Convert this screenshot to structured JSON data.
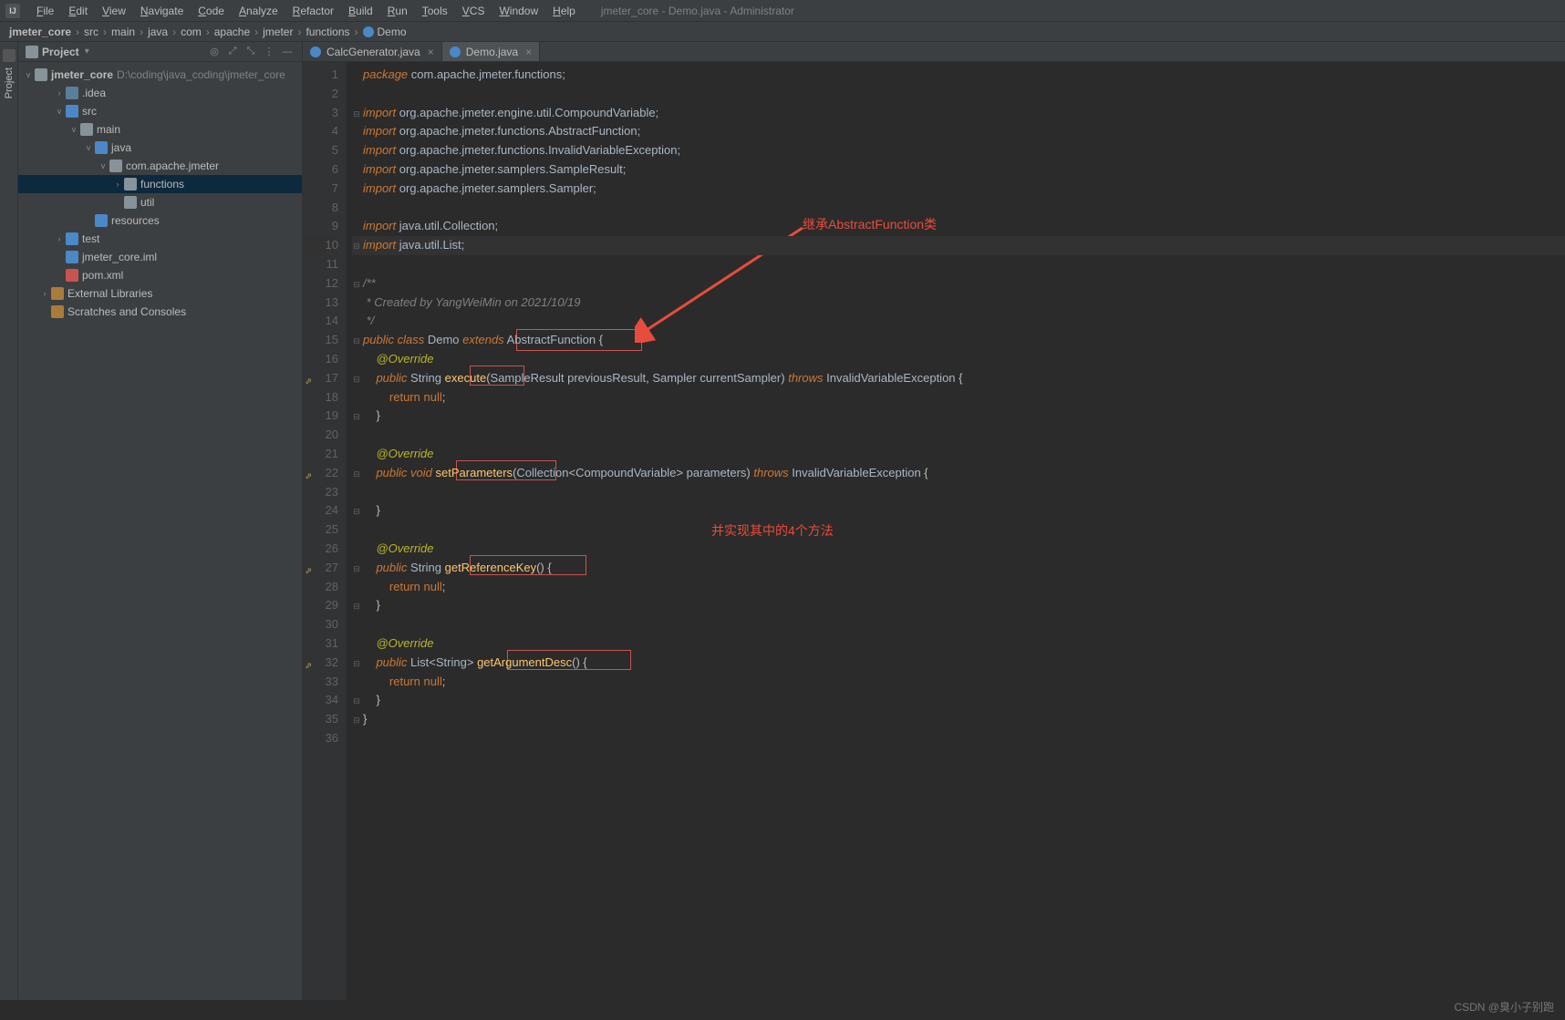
{
  "window": {
    "title": "jmeter_core - Demo.java - Administrator"
  },
  "menu": [
    "File",
    "Edit",
    "View",
    "Navigate",
    "Code",
    "Analyze",
    "Refactor",
    "Build",
    "Run",
    "Tools",
    "VCS",
    "Window",
    "Help"
  ],
  "breadcrumb": [
    "jmeter_core",
    "src",
    "main",
    "java",
    "com",
    "apache",
    "jmeter",
    "functions",
    "Demo"
  ],
  "project_panel": {
    "title": "Project",
    "root": {
      "label": "jmeter_core",
      "path": "D:\\coding\\java_coding\\jmeter_core"
    },
    "items": [
      {
        "indent": 1,
        "twist": "›",
        "icon": "ti-module",
        "label": ".idea"
      },
      {
        "indent": 1,
        "twist": "v",
        "icon": "ti-blue",
        "label": "src"
      },
      {
        "indent": 2,
        "twist": "v",
        "icon": "ti-folder",
        "label": "main"
      },
      {
        "indent": 3,
        "twist": "v",
        "icon": "ti-blue",
        "label": "java"
      },
      {
        "indent": 4,
        "twist": "v",
        "icon": "ti-pkg",
        "label": "com.apache.jmeter"
      },
      {
        "indent": 5,
        "twist": "›",
        "icon": "ti-pkg",
        "label": "functions",
        "sel": true
      },
      {
        "indent": 5,
        "twist": "",
        "icon": "ti-pkg",
        "label": "util"
      },
      {
        "indent": 3,
        "twist": "",
        "icon": "ti-blue",
        "label": "resources"
      },
      {
        "indent": 1,
        "twist": "›",
        "icon": "ti-blue",
        "label": "test"
      },
      {
        "indent": 1,
        "twist": "",
        "icon": "ti-iml",
        "label": "jmeter_core.iml"
      },
      {
        "indent": 1,
        "twist": "",
        "icon": "ti-xml",
        "label": "pom.xml"
      },
      {
        "indent": 0,
        "twist": "›",
        "icon": "ti-lib",
        "label": "External Libraries"
      },
      {
        "indent": 0,
        "twist": "",
        "icon": "ti-scratch",
        "label": "Scratches and Consoles"
      }
    ]
  },
  "tabs": [
    {
      "label": "CalcGenerator.java",
      "active": false
    },
    {
      "label": "Demo.java",
      "active": true
    }
  ],
  "code": {
    "lines": [
      {
        "n": 1,
        "fold": "",
        "html": "<span class='kw'>package</span> <span class='pkg'>com.apache.jmeter.functions;</span>"
      },
      {
        "n": 2,
        "fold": "",
        "html": ""
      },
      {
        "n": 3,
        "fold": "⊟",
        "html": "<span class='kw'>import</span> <span class='pkg'>org.apache.jmeter.engine.util.CompoundVariable;</span>"
      },
      {
        "n": 4,
        "fold": "",
        "html": "<span class='kw'>import</span> <span class='pkg'>org.apache.jmeter.functions.AbstractFunction;</span>"
      },
      {
        "n": 5,
        "fold": "",
        "html": "<span class='kw'>import</span> <span class='pkg'>org.apache.jmeter.functions.InvalidVariableException;</span>"
      },
      {
        "n": 6,
        "fold": "",
        "html": "<span class='kw'>import</span> <span class='pkg'>org.apache.jmeter.samplers.SampleResult;</span>"
      },
      {
        "n": 7,
        "fold": "",
        "html": "<span class='kw'>import</span> <span class='pkg'>org.apache.jmeter.samplers.Sampler;</span>"
      },
      {
        "n": 8,
        "fold": "",
        "html": ""
      },
      {
        "n": 9,
        "fold": "",
        "html": "<span class='kw'>import</span> <span class='pkg'>java.util.Collection;</span>"
      },
      {
        "n": 10,
        "fold": "⊟",
        "html": "<span class='kw'>import</span> <span class='pkg'>java.util.List;</span>",
        "hl": true
      },
      {
        "n": 11,
        "fold": "",
        "html": ""
      },
      {
        "n": 12,
        "fold": "⊟",
        "html": "<span class='cmt'>/**</span>"
      },
      {
        "n": 13,
        "fold": "",
        "html": "<span class='cmt'> * Created by YangWeiMin on 2021/10/19</span>"
      },
      {
        "n": 14,
        "fold": "",
        "html": "<span class='cmt'> */</span>"
      },
      {
        "n": 15,
        "fold": "⊟",
        "html": "<span class='kw'>public class</span> <span class='cls'>Demo</span> <span class='kw'>extends</span> <span class='cls'>AbstractFunction</span> {"
      },
      {
        "n": 16,
        "fold": "",
        "html": "    <span class='ann'>@Override</span>"
      },
      {
        "n": 17,
        "fold": "⊟",
        "html": "    <span class='kw'>public</span> <span class='cls'>String</span> <span class='method'>execute</span>(<span class='cls'>SampleResult</span> <span class='param'>previousResult</span>, <span class='cls'>Sampler</span> <span class='param'>currentSampler</span>) <span class='kw'>throws</span> <span class='cls'>InvalidVariableException</span> {",
        "mark": "↗"
      },
      {
        "n": 18,
        "fold": "",
        "html": "        <span class='kw2'>return</span> <span class='lit'>null</span>;"
      },
      {
        "n": 19,
        "fold": "⊟",
        "html": "    }"
      },
      {
        "n": 20,
        "fold": "",
        "html": ""
      },
      {
        "n": 21,
        "fold": "",
        "html": "    <span class='ann'>@Override</span>"
      },
      {
        "n": 22,
        "fold": "⊟",
        "html": "    <span class='kw'>public void</span> <span class='method'>setParameters</span>(<span class='cls'>Collection</span>&lt;<span class='cls'>CompoundVariable</span>&gt; <span class='param'>parameters</span>) <span class='kw'>throws</span> <span class='cls'>InvalidVariableException</span> {",
        "mark": "↗"
      },
      {
        "n": 23,
        "fold": "",
        "html": ""
      },
      {
        "n": 24,
        "fold": "⊟",
        "html": "    }"
      },
      {
        "n": 25,
        "fold": "",
        "html": ""
      },
      {
        "n": 26,
        "fold": "",
        "html": "    <span class='ann'>@Override</span>"
      },
      {
        "n": 27,
        "fold": "⊟",
        "html": "    <span class='kw'>public</span> <span class='cls'>String</span> <span class='method'>getReferenceKey</span>() {",
        "mark": "↗"
      },
      {
        "n": 28,
        "fold": "",
        "html": "        <span class='kw2'>return</span> <span class='lit'>null</span>;"
      },
      {
        "n": 29,
        "fold": "⊟",
        "html": "    }"
      },
      {
        "n": 30,
        "fold": "",
        "html": ""
      },
      {
        "n": 31,
        "fold": "",
        "html": "    <span class='ann'>@Override</span>"
      },
      {
        "n": 32,
        "fold": "⊟",
        "html": "    <span class='kw'>public</span> <span class='cls'>List</span>&lt;<span class='cls'>String</span>&gt; <span class='method'>getArgumentDesc</span>() {",
        "mark": "↗"
      },
      {
        "n": 33,
        "fold": "",
        "html": "        <span class='kw2'>return</span> <span class='lit'>null</span>;"
      },
      {
        "n": 34,
        "fold": "⊟",
        "html": "    }"
      },
      {
        "n": 35,
        "fold": "⊟",
        "html": "}"
      },
      {
        "n": 36,
        "fold": "",
        "html": ""
      }
    ]
  },
  "annotations": {
    "text1": "继承AbstractFunction类",
    "text2": "并实现其中的4个方法"
  },
  "watermark": "CSDN @臭小子别跑",
  "vtab_label": "Project"
}
